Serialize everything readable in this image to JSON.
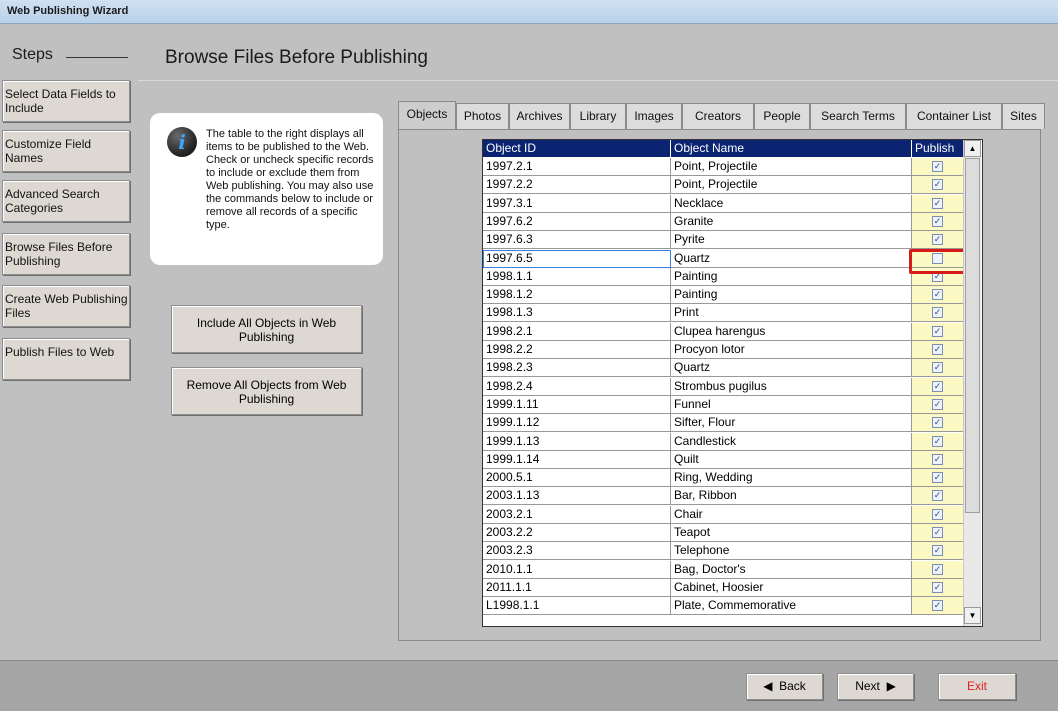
{
  "window": {
    "title": "Web Publishing Wizard"
  },
  "sidebar": {
    "heading": "Steps",
    "items": [
      {
        "label": "Select Data Fields to Include"
      },
      {
        "label": "Customize Field Names"
      },
      {
        "label": "Advanced Search Categories"
      },
      {
        "label": "Browse Files Before Publishing"
      },
      {
        "label": "Create Web Publishing Files"
      },
      {
        "label": "Publish Files to Web"
      }
    ]
  },
  "page": {
    "title": "Browse Files Before Publishing"
  },
  "info": {
    "icon": "info-icon",
    "text": "The table to the right displays all items to be published to the Web.  Check or uncheck specific records to include or exclude them from Web publishing.  You may also use the commands below to include or remove all records of a specific type."
  },
  "actions": {
    "include_all": "Include All Objects in Web Publishing",
    "remove_all": "Remove All Objects from Web Publishing"
  },
  "tabs": [
    {
      "label": "Objects"
    },
    {
      "label": "Photos"
    },
    {
      "label": "Archives"
    },
    {
      "label": "Library"
    },
    {
      "label": "Images"
    },
    {
      "label": "Creators"
    },
    {
      "label": "People"
    },
    {
      "label": "Search Terms"
    },
    {
      "label": "Container List"
    },
    {
      "label": "Sites"
    }
  ],
  "active_tab": "Objects",
  "grid": {
    "columns": [
      "Object ID",
      "Object Name",
      "Publish"
    ],
    "rows": [
      {
        "id": "1997.2.1",
        "name": "Point, Projectile",
        "publish": true
      },
      {
        "id": "1997.2.2",
        "name": "Point, Projectile",
        "publish": true
      },
      {
        "id": "1997.3.1",
        "name": "Necklace",
        "publish": true
      },
      {
        "id": "1997.6.2",
        "name": "Granite",
        "publish": true
      },
      {
        "id": "1997.6.3",
        "name": "Pyrite",
        "publish": true
      },
      {
        "id": "1997.6.5",
        "name": "Quartz",
        "publish": false
      },
      {
        "id": "1998.1.1",
        "name": "Painting",
        "publish": true
      },
      {
        "id": "1998.1.2",
        "name": "Painting",
        "publish": true
      },
      {
        "id": "1998.1.3",
        "name": "Print",
        "publish": true
      },
      {
        "id": "1998.2.1",
        "name": "Clupea harengus",
        "publish": true
      },
      {
        "id": "1998.2.2",
        "name": "Procyon lotor",
        "publish": true
      },
      {
        "id": "1998.2.3",
        "name": "Quartz",
        "publish": true
      },
      {
        "id": "1998.2.4",
        "name": "Strombus pugilus",
        "publish": true
      },
      {
        "id": "1999.1.11",
        "name": "Funnel",
        "publish": true
      },
      {
        "id": "1999.1.12",
        "name": "Sifter, Flour",
        "publish": true
      },
      {
        "id": "1999.1.13",
        "name": "Candlestick",
        "publish": true
      },
      {
        "id": "1999.1.14",
        "name": "Quilt",
        "publish": true
      },
      {
        "id": "2000.5.1",
        "name": "Ring, Wedding",
        "publish": true
      },
      {
        "id": "2003.1.13",
        "name": "Bar, Ribbon",
        "publish": true
      },
      {
        "id": "2003.2.1",
        "name": "Chair",
        "publish": true
      },
      {
        "id": "2003.2.2",
        "name": "Teapot",
        "publish": true
      },
      {
        "id": "2003.2.3",
        "name": "Telephone",
        "publish": true
      },
      {
        "id": "2010.1.1",
        "name": "Bag, Doctor's",
        "publish": true
      },
      {
        "id": "2011.1.1",
        "name": "Cabinet, Hoosier",
        "publish": true
      },
      {
        "id": "L1998.1.1",
        "name": "Plate, Commemorative",
        "publish": true
      }
    ],
    "selected_row": "1997.6.5"
  },
  "footer": {
    "back": "Back",
    "next": "Next",
    "exit": "Exit"
  },
  "colors": {
    "header_bg": "#0a2472",
    "publish_col_bg": "#fdf9c4",
    "highlight": "#d71a1a",
    "exit_text": "#e02020"
  }
}
